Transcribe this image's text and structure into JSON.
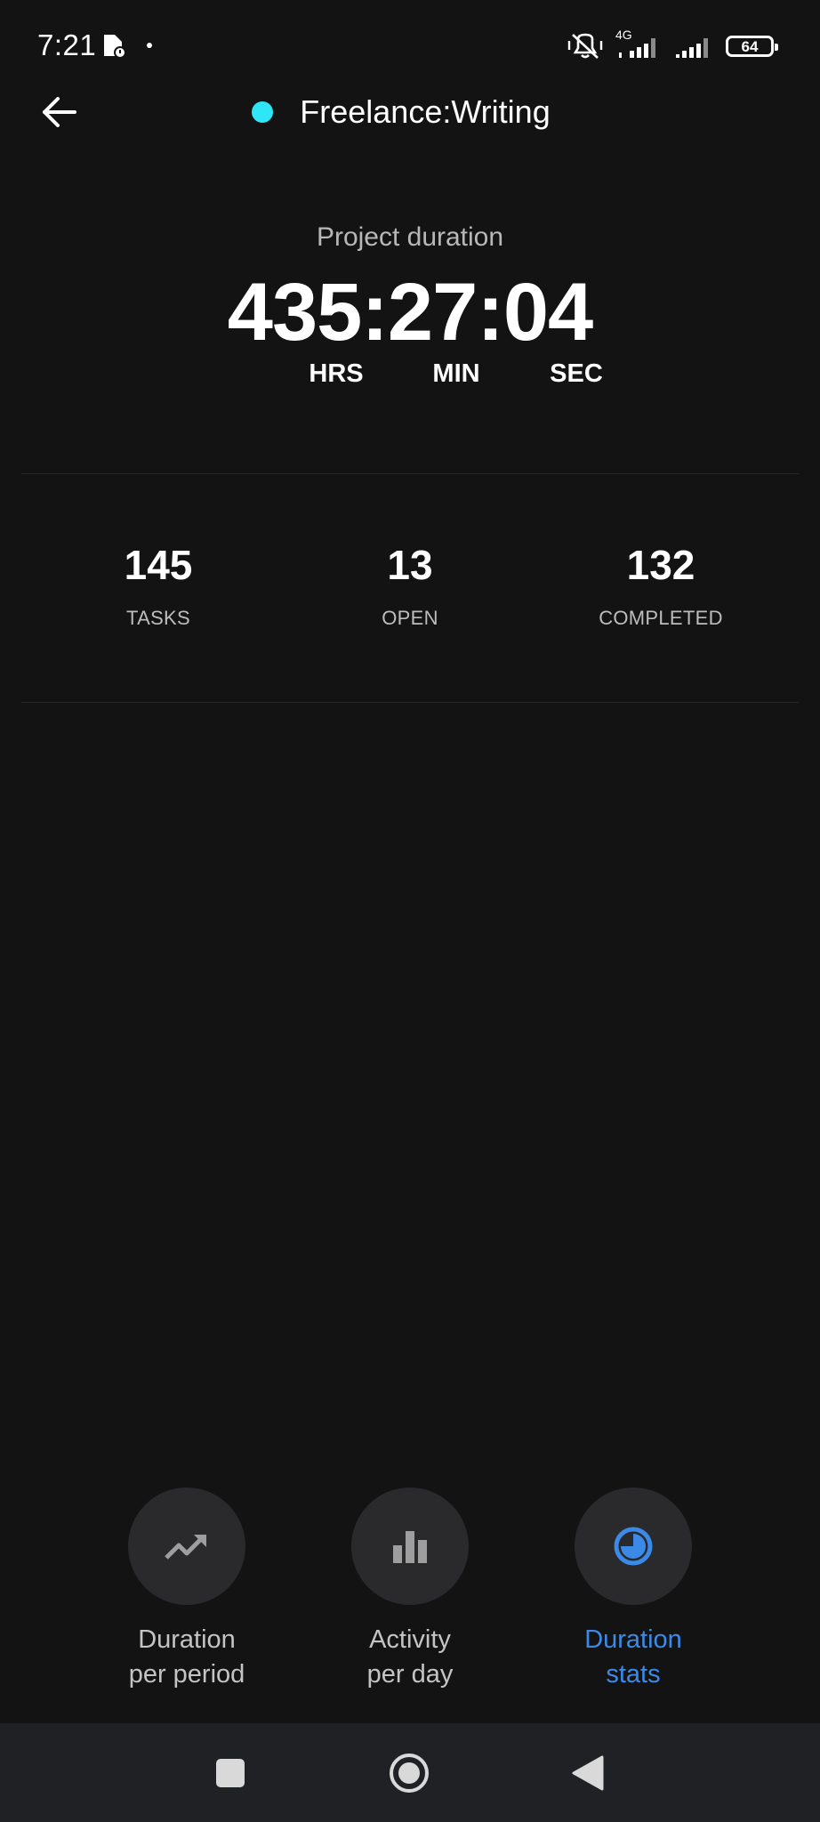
{
  "status_bar": {
    "time": "7:21",
    "network": "4G",
    "battery": "64"
  },
  "header": {
    "project_name": "Freelance:Writing",
    "project_color": "#2ee6f5"
  },
  "duration": {
    "label": "Project duration",
    "value": "435:27:04",
    "units": {
      "hours": "HRS",
      "minutes": "MIN",
      "seconds": "SEC"
    }
  },
  "stats": [
    {
      "value": "145",
      "label": "TASKS"
    },
    {
      "value": "13",
      "label": "OPEN"
    },
    {
      "value": "132",
      "label": "COMPLETED"
    }
  ],
  "actions": [
    {
      "line1": "Duration",
      "line2": "per period",
      "icon": "trending-up-icon",
      "active": false
    },
    {
      "line1": "Activity",
      "line2": "per day",
      "icon": "bar-chart-icon",
      "active": false
    },
    {
      "line1": "Duration",
      "line2": "stats",
      "icon": "pie-chart-icon",
      "active": true
    }
  ],
  "colors": {
    "background": "#131313",
    "accent": "#3b8ae8",
    "circle": "#2a2a2d",
    "nav_bar": "#202124"
  }
}
